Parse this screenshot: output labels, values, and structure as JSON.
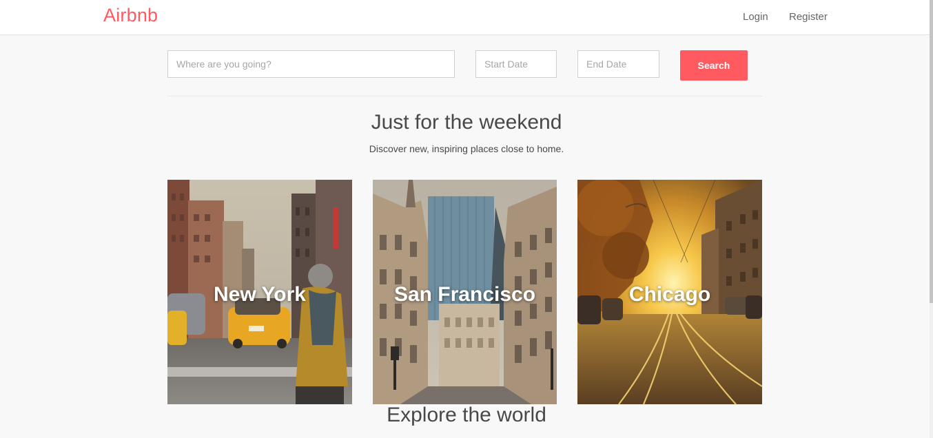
{
  "nav": {
    "brand": "Airbnb",
    "login": "Login",
    "register": "Register"
  },
  "search": {
    "destination_placeholder": "Where are you going?",
    "start_placeholder": "Start Date",
    "end_placeholder": "End Date",
    "button_label": "Search"
  },
  "weekend": {
    "title": "Just for the weekend",
    "subtitle": "Discover new, inspiring places close to home."
  },
  "cities": [
    {
      "name": "New York"
    },
    {
      "name": "San Francisco"
    },
    {
      "name": "Chicago"
    }
  ],
  "explore": {
    "title": "Explore the world"
  },
  "colors": {
    "brand": "#ff5a5f",
    "background": "#f8f8f8",
    "text": "#484848"
  }
}
